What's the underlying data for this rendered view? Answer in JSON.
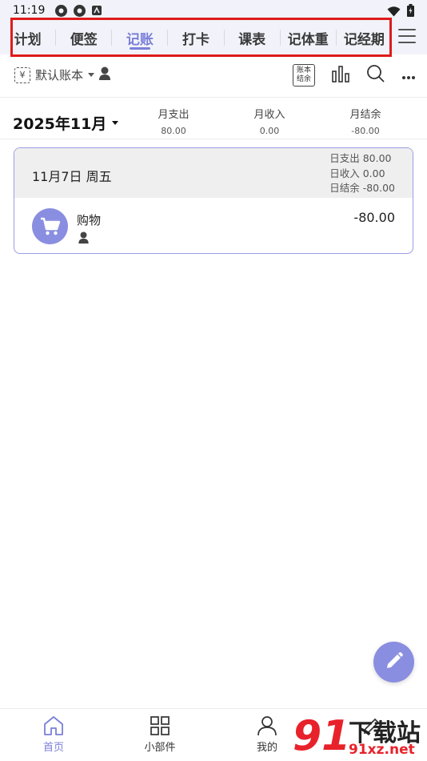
{
  "status_bar": {
    "time": "11:19"
  },
  "tabs": [
    {
      "label": "计划",
      "active": false
    },
    {
      "label": "便签",
      "active": false
    },
    {
      "label": "记账",
      "active": true
    },
    {
      "label": "打卡",
      "active": false
    },
    {
      "label": "课表",
      "active": false
    },
    {
      "label": "记体重",
      "active": false
    },
    {
      "label": "记经期",
      "active": false
    }
  ],
  "toolbar": {
    "ledger_icon": "¥",
    "ledger_name": "默认账本",
    "summary_icon_line1": "账本",
    "summary_icon_line2": "结余"
  },
  "month_summary": {
    "month": "2025年11月",
    "expense_label": "月支出",
    "expense_value": "80.00",
    "income_label": "月收入",
    "income_value": "0.00",
    "balance_label": "月结余",
    "balance_value": "-80.00"
  },
  "day_card": {
    "date": "11月7日 周五",
    "day_expense": "日支出 80.00",
    "day_income": "日收入 0.00",
    "day_balance": "日结余 -80.00",
    "entries": [
      {
        "category": "购物",
        "amount": "-80.00",
        "icon": "cart-icon"
      }
    ]
  },
  "bottom_nav": {
    "home": "首页",
    "widgets": "小部件",
    "mine": "我的",
    "fourth": ""
  },
  "watermark": {
    "title": "下载站",
    "url": "91xz.net",
    "logo": "91"
  },
  "colors": {
    "accent": "#7b7fd9",
    "fab": "#8a8ee0",
    "highlight": "#e01b1b"
  }
}
